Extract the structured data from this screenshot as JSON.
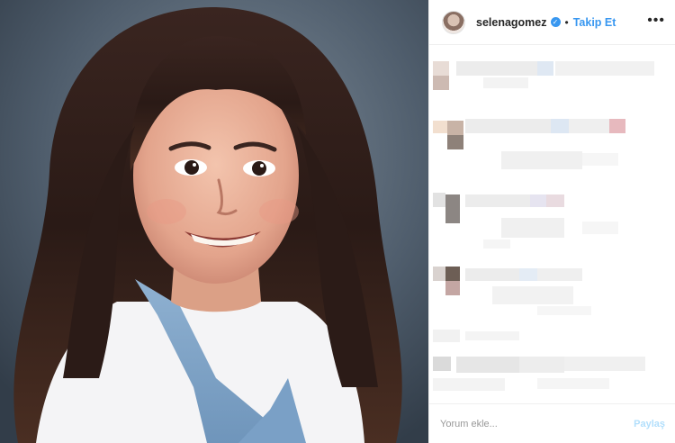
{
  "post": {
    "photo_icon": "portrait-photo",
    "username": "selenagomez",
    "verified_icon": "verified-badge-icon",
    "separator": "•",
    "follow_label": "Takip Et",
    "more_icon": "more-options-icon",
    "more_label": "•••"
  },
  "comments_area": {
    "state": "pixelated"
  },
  "footer": {
    "comment_placeholder": "Yorum ekle...",
    "share_label": "Paylaş"
  },
  "colors": {
    "link_blue": "#3897f0",
    "share_disabled": "#b2dffc",
    "border": "#efefef",
    "text": "#262626"
  }
}
